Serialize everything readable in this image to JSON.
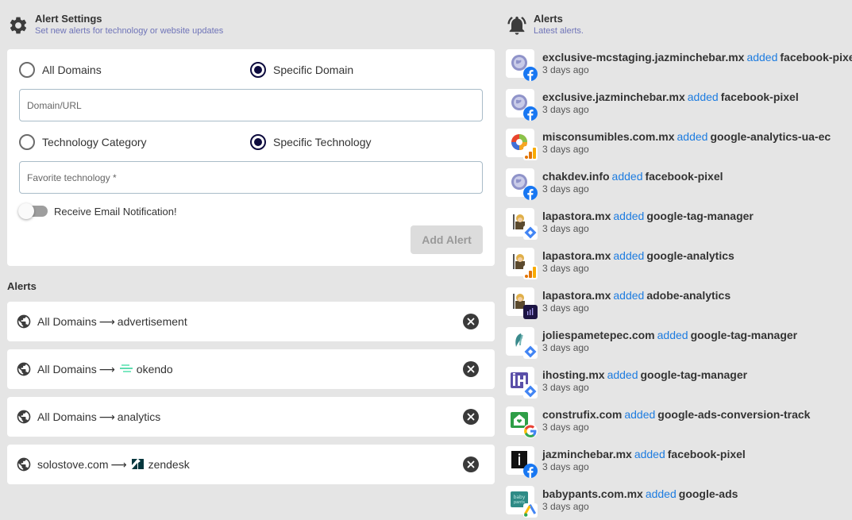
{
  "settings": {
    "title": "Alert Settings",
    "subtitle": "Set new alerts for technology or website updates",
    "domain_options": [
      {
        "label": "All Domains",
        "checked": false
      },
      {
        "label": "Specific Domain",
        "checked": true
      }
    ],
    "domain_input_placeholder": "Domain/URL",
    "domain_input_value": "",
    "tech_options": [
      {
        "label": "Technology Category",
        "checked": false
      },
      {
        "label": "Specific Technology",
        "checked": true
      }
    ],
    "tech_input_placeholder": "Favorite technology *",
    "tech_input_value": "",
    "email_toggle_label": "Receive Email Notification!",
    "email_toggle_on": false,
    "add_button_label": "Add Alert"
  },
  "my_alerts": {
    "label": "Alerts",
    "arrow": "⟶",
    "items": [
      {
        "scope": "All Domains",
        "tech": "advertisement",
        "tech_icon": "none"
      },
      {
        "scope": "All Domains",
        "tech": "okendo",
        "tech_icon": "okendo-logo"
      },
      {
        "scope": "All Domains",
        "tech": "analytics",
        "tech_icon": "none"
      },
      {
        "scope": "solostove.com",
        "tech": "zendesk",
        "tech_icon": "zendesk-logo"
      }
    ]
  },
  "feed": {
    "title": "Alerts",
    "subtitle": "Latest alerts.",
    "added_word": "added",
    "items": [
      {
        "domain": "exclusive-mcstaging.jazminchebar.mx",
        "tech": "facebook-pixel",
        "time": "3 days ago",
        "site_icon": "globe-placeholder",
        "tech_icon": "facebook"
      },
      {
        "domain": "exclusive.jazminchebar.mx",
        "tech": "facebook-pixel",
        "time": "3 days ago",
        "site_icon": "globe-placeholder",
        "tech_icon": "facebook"
      },
      {
        "domain": "misconsumibles.com.mx",
        "tech": "google-analytics-ua-ec",
        "time": "3 days ago",
        "site_icon": "misconsumibles",
        "tech_icon": "google-analytics"
      },
      {
        "domain": "chakdev.info",
        "tech": "facebook-pixel",
        "time": "3 days ago",
        "site_icon": "globe-placeholder",
        "tech_icon": "facebook"
      },
      {
        "domain": "lapastora.mx",
        "tech": "google-tag-manager",
        "time": "3 days ago",
        "site_icon": "lapastora",
        "tech_icon": "google-tag-manager"
      },
      {
        "domain": "lapastora.mx",
        "tech": "google-analytics",
        "time": "3 days ago",
        "site_icon": "lapastora",
        "tech_icon": "google-analytics"
      },
      {
        "domain": "lapastora.mx",
        "tech": "adobe-analytics",
        "time": "3 days ago",
        "site_icon": "lapastora",
        "tech_icon": "adobe-analytics"
      },
      {
        "domain": "joliespametepec.com",
        "tech": "google-tag-manager",
        "time": "3 days ago",
        "site_icon": "joliespa",
        "tech_icon": "google-tag-manager"
      },
      {
        "domain": "ihosting.mx",
        "tech": "google-tag-manager",
        "time": "3 days ago",
        "site_icon": "ihosting",
        "tech_icon": "google-tag-manager"
      },
      {
        "domain": "construfix.com",
        "tech": "google-ads-conversion-track",
        "time": "3 days ago",
        "site_icon": "construfix",
        "tech_icon": "google"
      },
      {
        "domain": "jazminchebar.mx",
        "tech": "facebook-pixel",
        "time": "3 days ago",
        "site_icon": "jazminchebar",
        "tech_icon": "facebook"
      },
      {
        "domain": "babypants.com.mx",
        "tech": "google-ads",
        "time": "3 days ago",
        "site_icon": "babypants",
        "tech_icon": "google-ads"
      }
    ]
  },
  "colors": {
    "background": "#e5e5e5",
    "subtitle": "#6f74b8",
    "added": "#1d7ce0",
    "radio_checked": "#0d0b3e"
  }
}
